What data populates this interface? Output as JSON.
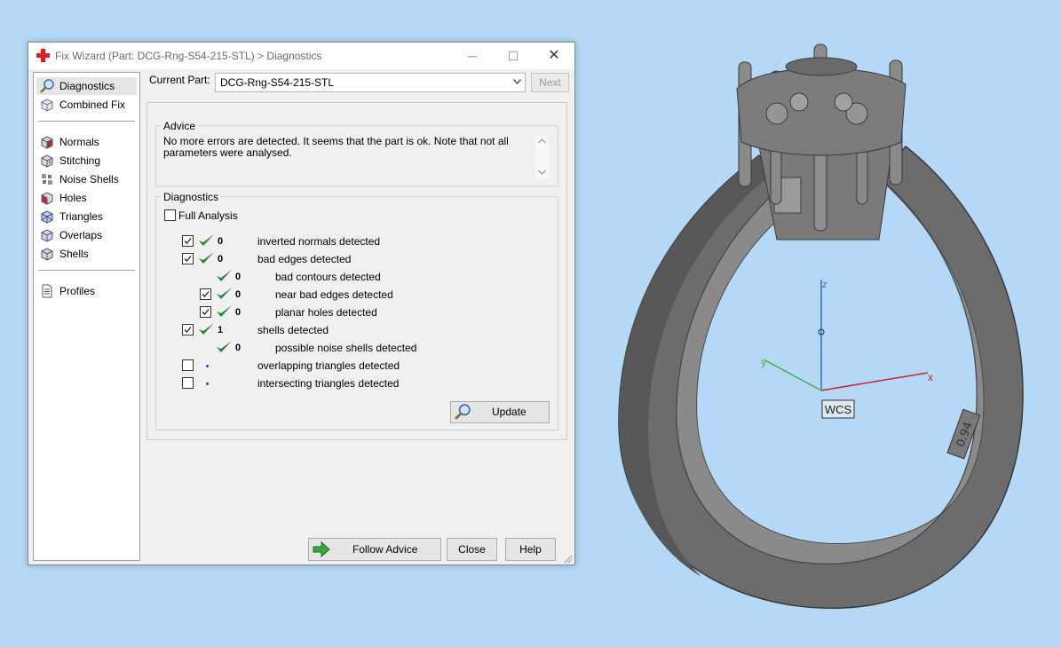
{
  "window": {
    "title": "Fix Wizard (Part: DCG-Rng-S54-215-STL) > Diagnostics",
    "minimize_glyph": "─",
    "maximize_glyph": "☐",
    "close_glyph": "✕"
  },
  "sidebar": {
    "items": [
      {
        "label": "Diagnostics",
        "icon": "magnifier-icon",
        "selected": true
      },
      {
        "label": "Combined Fix",
        "icon": "cube-icon"
      },
      {
        "label": "Normals",
        "icon": "cube-red-face-icon"
      },
      {
        "label": "Stitching",
        "icon": "cube-stitch-icon"
      },
      {
        "label": "Noise Shells",
        "icon": "dots-icon"
      },
      {
        "label": "Holes",
        "icon": "cube-hole-icon"
      },
      {
        "label": "Triangles",
        "icon": "triangles-icon"
      },
      {
        "label": "Overlaps",
        "icon": "cube-overlap-icon"
      },
      {
        "label": "Shells",
        "icon": "cube-shells-icon"
      },
      {
        "label": "Profiles",
        "icon": "document-icon"
      }
    ]
  },
  "header": {
    "current_part_label": "Current Part:",
    "current_part_value": "DCG-Rng-S54-215-STL",
    "next_label": "Next"
  },
  "advice": {
    "title": "Advice",
    "text": "No more errors are detected. It seems that the part is ok. Note that not all parameters were analysed."
  },
  "diagnostics": {
    "title": "Diagnostics",
    "full_analysis_label": "Full Analysis",
    "full_analysis_checked": false,
    "rows": [
      {
        "checkbox": true,
        "checked": true,
        "status": "ok",
        "count": "0",
        "text": "inverted normals detected",
        "indent": 0
      },
      {
        "checkbox": true,
        "checked": true,
        "status": "ok",
        "count": "0",
        "text": "bad edges detected",
        "indent": 0
      },
      {
        "checkbox": false,
        "checked": false,
        "status": "ok",
        "count": "0",
        "text": "bad contours detected",
        "indent": 1
      },
      {
        "checkbox": true,
        "checked": true,
        "status": "ok",
        "count": "0",
        "text": "near bad edges detected",
        "indent": 1
      },
      {
        "checkbox": true,
        "checked": true,
        "status": "ok",
        "count": "0",
        "text": "planar holes detected",
        "indent": 1
      },
      {
        "checkbox": true,
        "checked": true,
        "status": "ok",
        "count": "1",
        "text": "shells detected",
        "indent": 0
      },
      {
        "checkbox": false,
        "checked": false,
        "status": "ok",
        "count": "0",
        "text": "possible noise shells detected",
        "indent": 1
      },
      {
        "checkbox": true,
        "checked": false,
        "status": "pending",
        "count": "",
        "text": "overlapping triangles detected",
        "indent": 0
      },
      {
        "checkbox": true,
        "checked": false,
        "status": "pending",
        "count": "",
        "text": "intersecting triangles detected",
        "indent": 0
      }
    ],
    "update_label": "Update"
  },
  "footer": {
    "follow_advice_label": "Follow Advice",
    "close_label": "Close",
    "help_label": "Help"
  },
  "viewport": {
    "wcs_label": "WCS",
    "axis_x": "x",
    "axis_y": "y",
    "axis_z": "z",
    "engraving": "0.94",
    "colors": {
      "x_axis": "#c0262a",
      "y_axis": "#46b44a",
      "z_axis": "#2f6fd0",
      "model": "#6f6f6f",
      "background": "#b4d8f5"
    }
  }
}
